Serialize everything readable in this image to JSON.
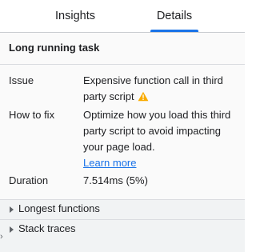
{
  "tabs": [
    {
      "label": "Insights",
      "selected": false
    },
    {
      "label": "Details",
      "selected": true
    }
  ],
  "colors": {
    "accent": "#1a73e8",
    "warning": "#f9ab00"
  },
  "details": {
    "title": "Long running task",
    "issue": {
      "label": "Issue",
      "value": "Expensive function call in third party script",
      "icon": "warning-icon"
    },
    "how_to_fix": {
      "label": "How to fix",
      "value": "Optimize how you load this third party script to avoid impacting your page load.",
      "link": "Learn more"
    },
    "duration": {
      "label": "Duration",
      "value": "7.514ms (5%)"
    }
  },
  "sections": [
    {
      "label": "Longest functions",
      "expanded": false
    },
    {
      "label": "Stack traces",
      "expanded": false
    }
  ]
}
